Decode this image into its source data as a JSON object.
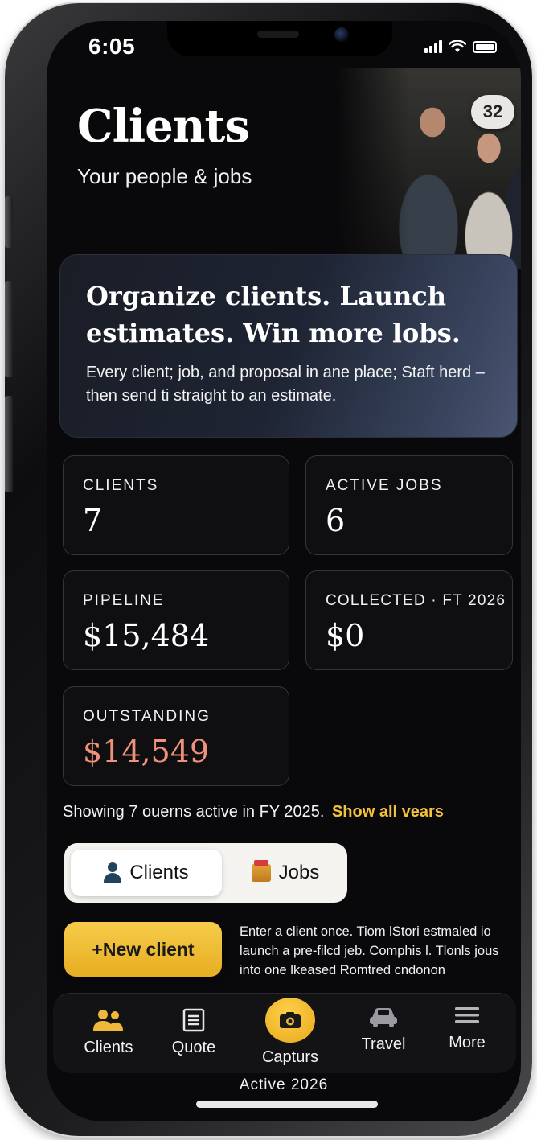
{
  "status_bar": {
    "time": "6:05"
  },
  "header": {
    "title": "Clients",
    "subtitle": "Your people & jobs",
    "badge_count": "32"
  },
  "promo": {
    "title": "Organize clients. Launch estimates. Win more lobs.",
    "body": "Every client; job, and proposal in ane place; Staft herd – then send ti straight to an estimate."
  },
  "stats": [
    {
      "label": "CLIENTS",
      "value": "7"
    },
    {
      "label": "ACTIVE JOBS",
      "value": "6"
    },
    {
      "label": "PIPELINE",
      "value": "$15,484"
    },
    {
      "label": "COLLECTED · FT 2026",
      "value": "$0"
    },
    {
      "label": "OUTSTANDING",
      "value": "$14,549"
    }
  ],
  "filter": {
    "text": "Showing 7 ouerns active in FY 2025.",
    "link": "Show all vears"
  },
  "segmented": {
    "clients_label": "Clients",
    "jobs_label": "Jobs"
  },
  "cta": {
    "new_client_label": "+New client",
    "help_text": "Enter a client once. Tiom lStori estmaled io launch a pre-filcd jeb. Comphis l. Tlonls jous into one lkeased Romtred cndonon"
  },
  "tabbar": {
    "items": [
      {
        "label": "Clients",
        "icon": "people-icon"
      },
      {
        "label": "Quote",
        "icon": "document-icon"
      },
      {
        "label": "Capturs",
        "icon": "camera-icon"
      },
      {
        "label": "Travel",
        "icon": "car-icon"
      },
      {
        "label": "More",
        "icon": "menu-icon"
      }
    ]
  },
  "footer": {
    "label": "Active  2026"
  },
  "colors": {
    "accent": "#f2c23b",
    "alert": "#f0927a",
    "background": "#09090b"
  }
}
